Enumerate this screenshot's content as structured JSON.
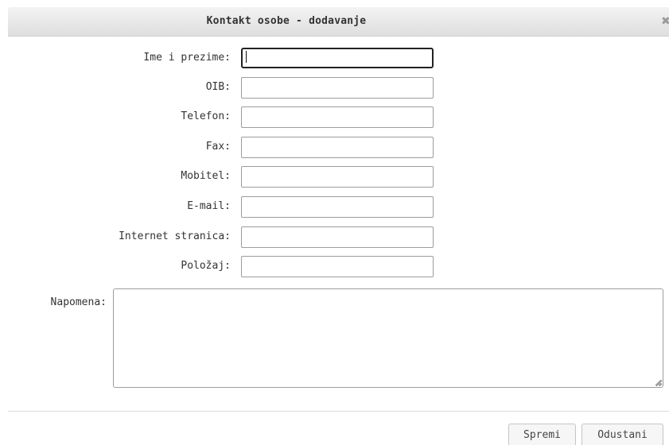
{
  "dialog": {
    "title": "Kontakt osobe - dodavanje",
    "close_glyph": "✖"
  },
  "form": {
    "fields": [
      {
        "label": "Ime i prezime:",
        "value": ""
      },
      {
        "label": "OIB:",
        "value": ""
      },
      {
        "label": "Telefon:",
        "value": ""
      },
      {
        "label": "Fax:",
        "value": ""
      },
      {
        "label": "Mobitel:",
        "value": ""
      },
      {
        "label": "E-mail:",
        "value": ""
      },
      {
        "label": "Internet stranica:",
        "value": ""
      },
      {
        "label": "Položaj:",
        "value": ""
      }
    ],
    "note_label": "Napomena:",
    "note_value": ""
  },
  "buttons": {
    "save": "Spremi",
    "cancel": "Odustani"
  },
  "colors": {
    "titlebar": "#e6e6e6",
    "border": "#9c9c9c",
    "focus_border": "#222222",
    "button_bg": "#f6f6f6"
  }
}
